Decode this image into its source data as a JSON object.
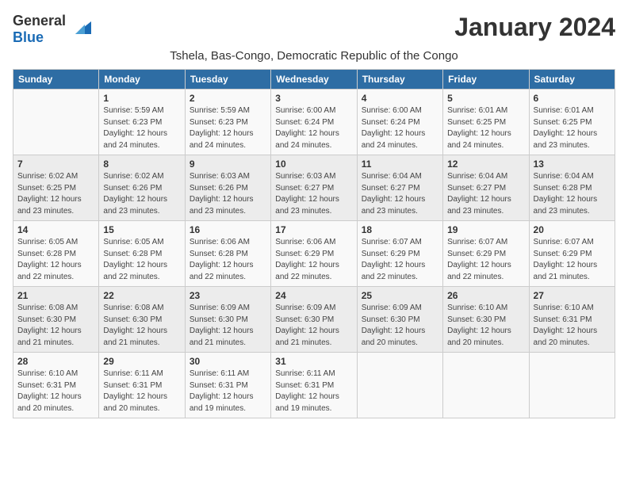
{
  "header": {
    "logo_general": "General",
    "logo_blue": "Blue",
    "month_title": "January 2024",
    "location": "Tshela, Bas-Congo, Democratic Republic of the Congo"
  },
  "days_of_week": [
    "Sunday",
    "Monday",
    "Tuesday",
    "Wednesday",
    "Thursday",
    "Friday",
    "Saturday"
  ],
  "weeks": [
    [
      {
        "day": null,
        "detail": null
      },
      {
        "day": "1",
        "detail": "Sunrise: 5:59 AM\nSunset: 6:23 PM\nDaylight: 12 hours\nand 24 minutes."
      },
      {
        "day": "2",
        "detail": "Sunrise: 5:59 AM\nSunset: 6:23 PM\nDaylight: 12 hours\nand 24 minutes."
      },
      {
        "day": "3",
        "detail": "Sunrise: 6:00 AM\nSunset: 6:24 PM\nDaylight: 12 hours\nand 24 minutes."
      },
      {
        "day": "4",
        "detail": "Sunrise: 6:00 AM\nSunset: 6:24 PM\nDaylight: 12 hours\nand 24 minutes."
      },
      {
        "day": "5",
        "detail": "Sunrise: 6:01 AM\nSunset: 6:25 PM\nDaylight: 12 hours\nand 24 minutes."
      },
      {
        "day": "6",
        "detail": "Sunrise: 6:01 AM\nSunset: 6:25 PM\nDaylight: 12 hours\nand 23 minutes."
      }
    ],
    [
      {
        "day": "7",
        "detail": "Sunrise: 6:02 AM\nSunset: 6:25 PM\nDaylight: 12 hours\nand 23 minutes."
      },
      {
        "day": "8",
        "detail": "Sunrise: 6:02 AM\nSunset: 6:26 PM\nDaylight: 12 hours\nand 23 minutes."
      },
      {
        "day": "9",
        "detail": "Sunrise: 6:03 AM\nSunset: 6:26 PM\nDaylight: 12 hours\nand 23 minutes."
      },
      {
        "day": "10",
        "detail": "Sunrise: 6:03 AM\nSunset: 6:27 PM\nDaylight: 12 hours\nand 23 minutes."
      },
      {
        "day": "11",
        "detail": "Sunrise: 6:04 AM\nSunset: 6:27 PM\nDaylight: 12 hours\nand 23 minutes."
      },
      {
        "day": "12",
        "detail": "Sunrise: 6:04 AM\nSunset: 6:27 PM\nDaylight: 12 hours\nand 23 minutes."
      },
      {
        "day": "13",
        "detail": "Sunrise: 6:04 AM\nSunset: 6:28 PM\nDaylight: 12 hours\nand 23 minutes."
      }
    ],
    [
      {
        "day": "14",
        "detail": "Sunrise: 6:05 AM\nSunset: 6:28 PM\nDaylight: 12 hours\nand 22 minutes."
      },
      {
        "day": "15",
        "detail": "Sunrise: 6:05 AM\nSunset: 6:28 PM\nDaylight: 12 hours\nand 22 minutes."
      },
      {
        "day": "16",
        "detail": "Sunrise: 6:06 AM\nSunset: 6:28 PM\nDaylight: 12 hours\nand 22 minutes."
      },
      {
        "day": "17",
        "detail": "Sunrise: 6:06 AM\nSunset: 6:29 PM\nDaylight: 12 hours\nand 22 minutes."
      },
      {
        "day": "18",
        "detail": "Sunrise: 6:07 AM\nSunset: 6:29 PM\nDaylight: 12 hours\nand 22 minutes."
      },
      {
        "day": "19",
        "detail": "Sunrise: 6:07 AM\nSunset: 6:29 PM\nDaylight: 12 hours\nand 22 minutes."
      },
      {
        "day": "20",
        "detail": "Sunrise: 6:07 AM\nSunset: 6:29 PM\nDaylight: 12 hours\nand 21 minutes."
      }
    ],
    [
      {
        "day": "21",
        "detail": "Sunrise: 6:08 AM\nSunset: 6:30 PM\nDaylight: 12 hours\nand 21 minutes."
      },
      {
        "day": "22",
        "detail": "Sunrise: 6:08 AM\nSunset: 6:30 PM\nDaylight: 12 hours\nand 21 minutes."
      },
      {
        "day": "23",
        "detail": "Sunrise: 6:09 AM\nSunset: 6:30 PM\nDaylight: 12 hours\nand 21 minutes."
      },
      {
        "day": "24",
        "detail": "Sunrise: 6:09 AM\nSunset: 6:30 PM\nDaylight: 12 hours\nand 21 minutes."
      },
      {
        "day": "25",
        "detail": "Sunrise: 6:09 AM\nSunset: 6:30 PM\nDaylight: 12 hours\nand 20 minutes."
      },
      {
        "day": "26",
        "detail": "Sunrise: 6:10 AM\nSunset: 6:30 PM\nDaylight: 12 hours\nand 20 minutes."
      },
      {
        "day": "27",
        "detail": "Sunrise: 6:10 AM\nSunset: 6:31 PM\nDaylight: 12 hours\nand 20 minutes."
      }
    ],
    [
      {
        "day": "28",
        "detail": "Sunrise: 6:10 AM\nSunset: 6:31 PM\nDaylight: 12 hours\nand 20 minutes."
      },
      {
        "day": "29",
        "detail": "Sunrise: 6:11 AM\nSunset: 6:31 PM\nDaylight: 12 hours\nand 20 minutes."
      },
      {
        "day": "30",
        "detail": "Sunrise: 6:11 AM\nSunset: 6:31 PM\nDaylight: 12 hours\nand 19 minutes."
      },
      {
        "day": "31",
        "detail": "Sunrise: 6:11 AM\nSunset: 6:31 PM\nDaylight: 12 hours\nand 19 minutes."
      },
      {
        "day": null,
        "detail": null
      },
      {
        "day": null,
        "detail": null
      },
      {
        "day": null,
        "detail": null
      }
    ]
  ]
}
